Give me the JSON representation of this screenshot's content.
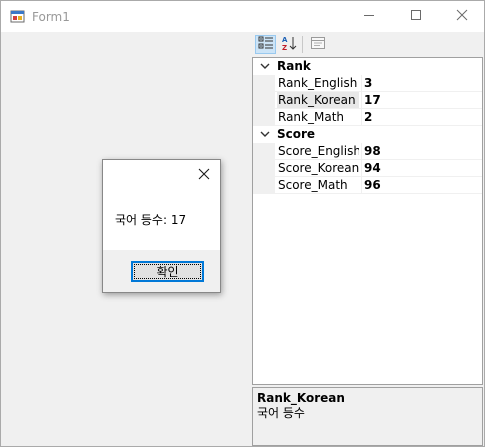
{
  "window": {
    "title": "Form1",
    "icons": {
      "app": "form-app-icon",
      "minimize": "minimize-icon",
      "maximize": "maximize-icon",
      "close": "close-icon"
    }
  },
  "property_grid": {
    "toolbar": {
      "categorized": "categorized-icon",
      "alphabetical": "alphabetical-sort-icon",
      "property_pages": "property-pages-icon"
    },
    "categories": [
      {
        "label": "Rank",
        "properties": [
          {
            "name": "Rank_English",
            "value": "3"
          },
          {
            "name": "Rank_Korean",
            "value": "17"
          },
          {
            "name": "Rank_Math",
            "value": "2"
          }
        ]
      },
      {
        "label": "Score",
        "properties": [
          {
            "name": "Score_English",
            "value": "98"
          },
          {
            "name": "Score_Korean",
            "value": "94"
          },
          {
            "name": "Score_Math",
            "value": "96"
          }
        ]
      }
    ],
    "selected_property": "Rank_Korean",
    "help": {
      "title": "Rank_Korean",
      "description": "국어 등수"
    }
  },
  "message_box": {
    "text": "국어 등수: 17",
    "ok_label": "확인"
  }
}
